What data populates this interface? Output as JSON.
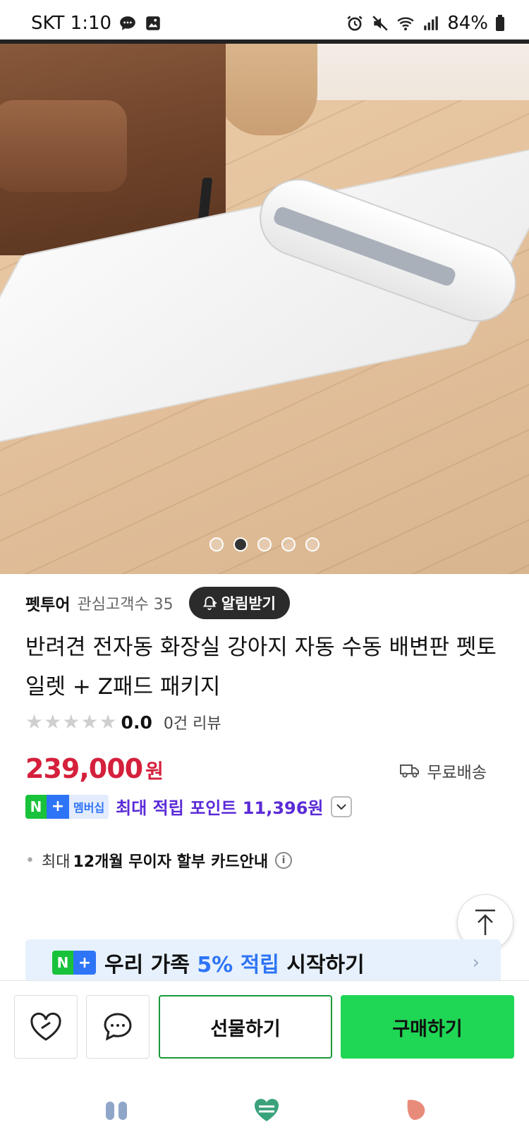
{
  "status_bar": {
    "carrier_time": "SKT 1:10",
    "battery": "84%",
    "icons_left": [
      "chat-bubble-icon",
      "gallery-icon"
    ],
    "icons_right": [
      "alarm-icon",
      "mute-icon",
      "wifi-icon",
      "signal-icon",
      "battery-icon"
    ]
  },
  "product_image": {
    "carousel_total": 5,
    "carousel_active_index": 1
  },
  "store": {
    "name": "펫투어",
    "subscriber_text": "관심고객수 35",
    "alert_button": "알림받기"
  },
  "product": {
    "title": "반려견 전자동 화장실 강아지 자동 수동 배변판 펫토일렛 + Z패드 패키지",
    "rating_value": "0.0",
    "review_count": "0건 리뷰",
    "stars_total": 5,
    "stars_filled": 0,
    "price": "239,000",
    "price_unit": "원",
    "shipping": "무료배송"
  },
  "membership": {
    "badge_n": "N",
    "badge_plus": "+",
    "badge_label": "멤버십",
    "text": "최대 적립 포인트 11,396원"
  },
  "installment": {
    "prefix": "최대",
    "highlight": "12개월 무이자 할부",
    "suffix": "카드안내"
  },
  "banner": {
    "text_part1": "우리 가족",
    "text_highlight": "5% 적립",
    "text_part2": "시작하기"
  },
  "actions": {
    "gift_label": "선물하기",
    "buy_label": "구매하기"
  },
  "colors": {
    "price": "#d5203c",
    "buy_button": "#1fd655",
    "naver_green": "#19c23b",
    "naver_blue": "#2e74f6",
    "membership_text": "#5b2bd7"
  }
}
